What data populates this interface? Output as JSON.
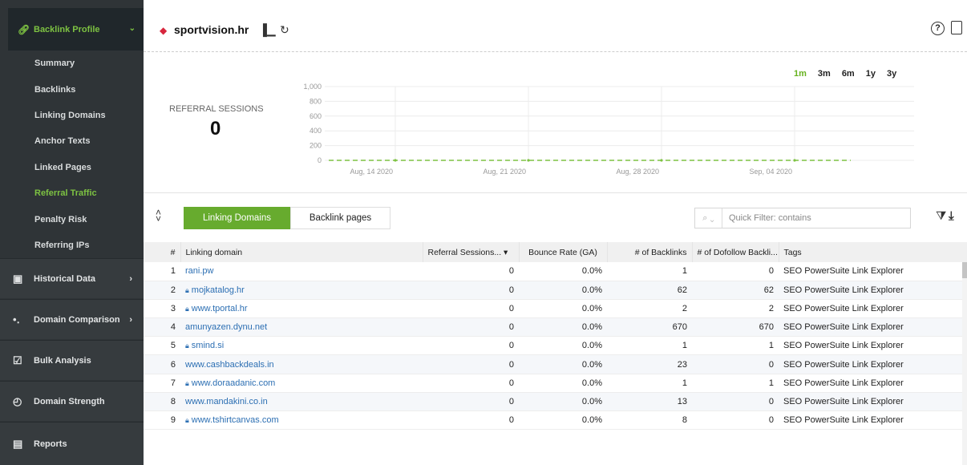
{
  "sidebar": {
    "header": {
      "label": "Backlink Profile"
    },
    "items": [
      {
        "label": "Summary"
      },
      {
        "label": "Backlinks"
      },
      {
        "label": "Linking Domains"
      },
      {
        "label": "Anchor Texts"
      },
      {
        "label": "Linked Pages"
      },
      {
        "label": "Referral Traffic",
        "active": true
      },
      {
        "label": "Penalty Risk"
      },
      {
        "label": "Referring IPs"
      }
    ],
    "sections": [
      {
        "label": "Historical Data",
        "icon": "calendar-icon"
      },
      {
        "label": "Domain Comparison",
        "icon": "bubbles-icon"
      },
      {
        "label": "Bulk Analysis",
        "icon": "checklist-icon"
      },
      {
        "label": "Domain Strength",
        "icon": "gauge-icon"
      },
      {
        "label": "Reports",
        "icon": "report-icon"
      }
    ]
  },
  "header": {
    "site": "sportvision.hr"
  },
  "metric": {
    "label": "REFERRAL SESSIONS",
    "value": "0"
  },
  "ranges": [
    "1m",
    "3m",
    "6m",
    "1y",
    "3y"
  ],
  "selected_range": "1m",
  "chart_data": {
    "type": "line",
    "x": [
      "Aug, 14 2020",
      "Aug, 21 2020",
      "Aug, 28 2020",
      "Sep, 04 2020"
    ],
    "y_ticks": [
      "1,000",
      "800",
      "600",
      "400",
      "200",
      "0"
    ],
    "ylim": [
      0,
      1000
    ],
    "series": [
      {
        "values": [
          0,
          0,
          0,
          0
        ],
        "color": "#7dc242"
      }
    ],
    "grid": true
  },
  "tabs": [
    {
      "label": "Linking Domains",
      "active": true
    },
    {
      "label": "Backlink pages"
    }
  ],
  "filter": {
    "placeholder": "Quick Filter: contains"
  },
  "table": {
    "columns": [
      "#",
      "Linking domain",
      "Referral Sessions...",
      "Bounce Rate (GA)",
      "# of Backlinks",
      "# of Dofollow Backli...",
      "Tags"
    ],
    "rows": [
      {
        "n": "1",
        "domain": "rani.pw",
        "lock": false,
        "sessions": "0",
        "bounce": "0.0%",
        "backlinks": "1",
        "dofollow": "0",
        "tags": "SEO PowerSuite Link Explorer"
      },
      {
        "n": "2",
        "domain": "mojkatalog.hr",
        "lock": true,
        "sessions": "0",
        "bounce": "0.0%",
        "backlinks": "62",
        "dofollow": "62",
        "tags": "SEO PowerSuite Link Explorer"
      },
      {
        "n": "3",
        "domain": "www.tportal.hr",
        "lock": true,
        "sessions": "0",
        "bounce": "0.0%",
        "backlinks": "2",
        "dofollow": "2",
        "tags": "SEO PowerSuite Link Explorer"
      },
      {
        "n": "4",
        "domain": "amunyazen.dynu.net",
        "lock": false,
        "sessions": "0",
        "bounce": "0.0%",
        "backlinks": "670",
        "dofollow": "670",
        "tags": "SEO PowerSuite Link Explorer"
      },
      {
        "n": "5",
        "domain": "smind.si",
        "lock": true,
        "sessions": "0",
        "bounce": "0.0%",
        "backlinks": "1",
        "dofollow": "1",
        "tags": "SEO PowerSuite Link Explorer"
      },
      {
        "n": "6",
        "domain": "www.cashbackdeals.in",
        "lock": false,
        "sessions": "0",
        "bounce": "0.0%",
        "backlinks": "23",
        "dofollow": "0",
        "tags": "SEO PowerSuite Link Explorer"
      },
      {
        "n": "7",
        "domain": "www.doraadanic.com",
        "lock": true,
        "sessions": "0",
        "bounce": "0.0%",
        "backlinks": "1",
        "dofollow": "1",
        "tags": "SEO PowerSuite Link Explorer"
      },
      {
        "n": "8",
        "domain": "www.mandakini.co.in",
        "lock": false,
        "sessions": "0",
        "bounce": "0.0%",
        "backlinks": "13",
        "dofollow": "0",
        "tags": "SEO PowerSuite Link Explorer"
      },
      {
        "n": "9",
        "domain": "www.tshirtcanvas.com",
        "lock": true,
        "sessions": "0",
        "bounce": "0.0%",
        "backlinks": "8",
        "dofollow": "0",
        "tags": "SEO PowerSuite Link Explorer"
      }
    ]
  }
}
